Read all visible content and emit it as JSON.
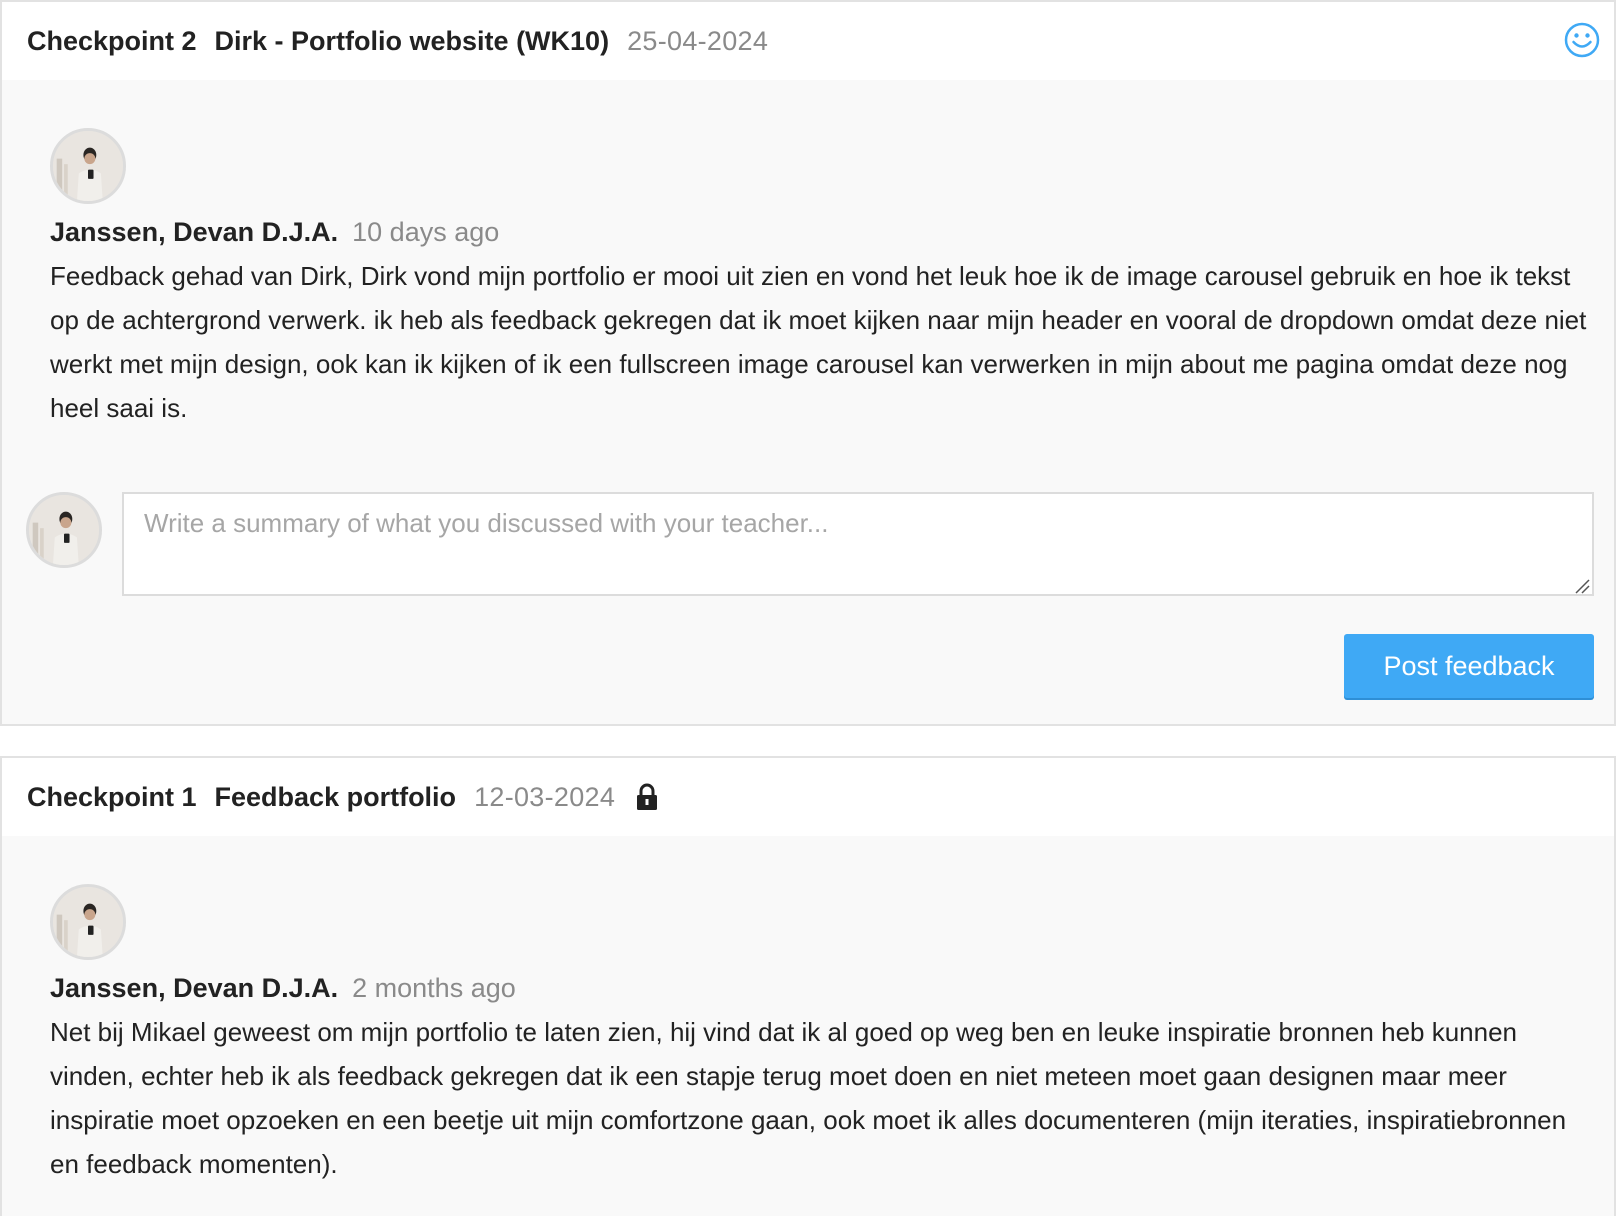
{
  "checkpoints": [
    {
      "label": "Checkpoint 2",
      "title": "Dirk - Portfolio website (WK10)",
      "date": "25-04-2024",
      "status_icon": "smiley-icon",
      "entry": {
        "author": "Janssen, Devan D.J.A.",
        "time_ago": "10 days ago",
        "text": "Feedback gehad van Dirk, Dirk vond mijn portfolio er mooi uit zien en vond het leuk hoe ik de image carousel gebruik en hoe ik tekst op de achtergrond verwerk. ik heb als feedback gekregen dat ik moet kijken naar mijn header en vooral de dropdown omdat deze niet werkt met mijn design, ook kan ik kijken of ik een fullscreen image carousel kan verwerken in mijn about me pagina omdat deze nog heel saai is."
      },
      "composer": {
        "placeholder": "Write a summary of what you discussed with your teacher...",
        "value": "",
        "post_label": "Post feedback"
      }
    },
    {
      "label": "Checkpoint 1",
      "title": "Feedback portfolio",
      "date": "12-03-2024",
      "status_icon": "lock-icon",
      "entry": {
        "author": "Janssen, Devan D.J.A.",
        "time_ago": "2 months ago",
        "text": "Net bij Mikael geweest om mijn portfolio te laten zien, hij vind dat ik al goed op weg ben en leuke inspiratie bronnen heb kunnen vinden, echter heb ik als feedback gekregen dat ik een stapje terug moet doen en niet meteen moet gaan designen maar meer inspiratie moet opzoeken en een beetje uit mijn comfortzone gaan, ook moet ik alles documenteren (mijn iteraties, inspiratiebronnen en feedback momenten)."
      }
    }
  ],
  "colors": {
    "accent": "#3fa9f5",
    "muted_text": "#8a8a8a",
    "card_bg": "#f9f9f9",
    "border": "#e2e2e2"
  }
}
